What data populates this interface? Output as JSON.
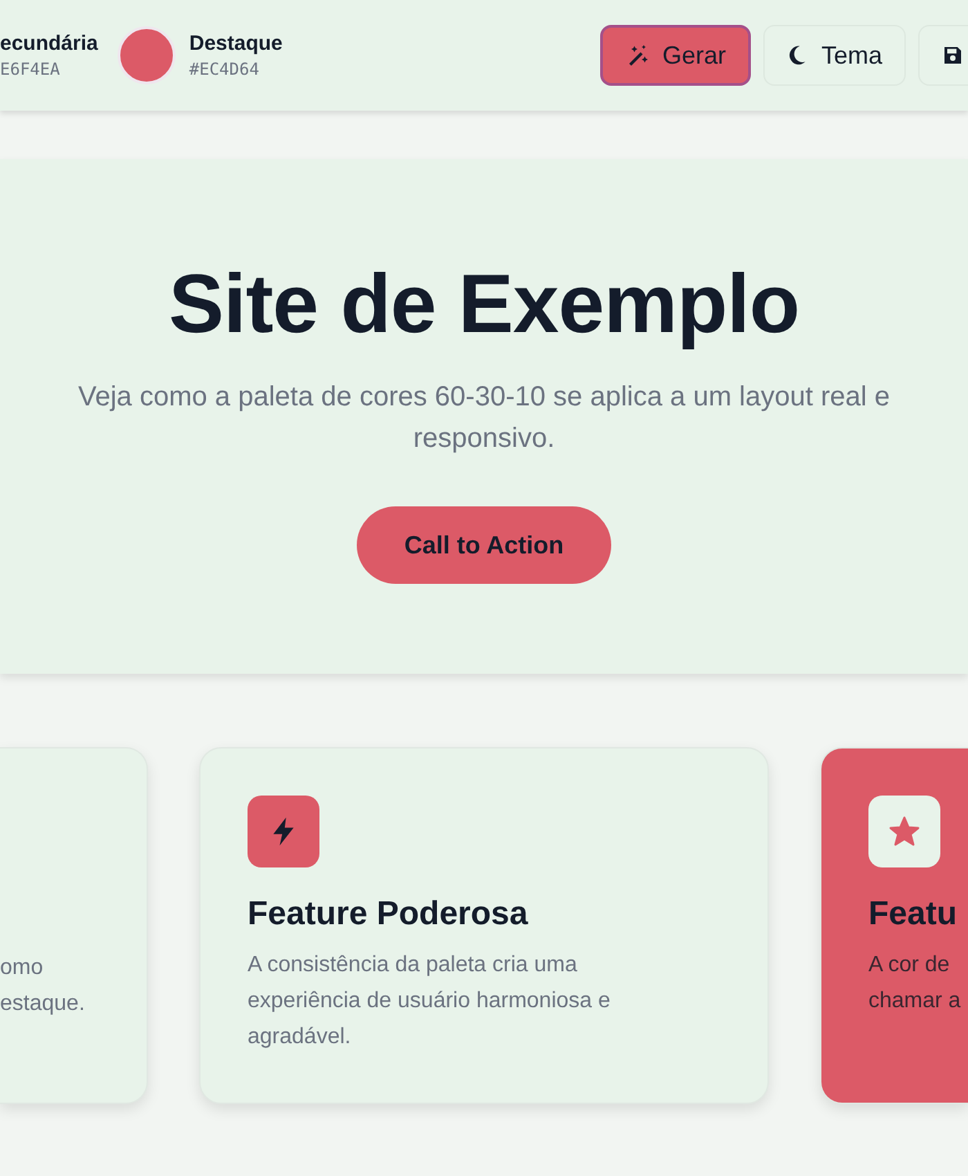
{
  "palette": [
    {
      "name": "ecundária",
      "hex": "E6F4EA"
    },
    {
      "name": "Destaque",
      "hex": "#EC4D64",
      "color": "#dc5a67"
    }
  ],
  "toolbar": [
    {
      "kind": "generate",
      "label": "Gerar",
      "focused": true
    },
    {
      "kind": "theme",
      "label": "Tema",
      "focused": false
    },
    {
      "kind": "save",
      "focused": false
    }
  ],
  "hero": {
    "title": "Site de Exemplo",
    "subtitle": "Veja como a paleta de cores 60-30-10 se aplica a um layout real e responsivo.",
    "cta": "Call to Action"
  },
  "features": [
    {
      "kind": "partial-left",
      "lines": [
        "omo",
        "estaque."
      ]
    },
    {
      "kind": "normal",
      "title": "Feature Poderosa",
      "text": "A consistência da paleta cria uma experiência de usuário harmoniosa e agradável."
    },
    {
      "kind": "accent",
      "title": "Featu",
      "lines": [
        "A cor de",
        "chamar a"
      ]
    }
  ]
}
